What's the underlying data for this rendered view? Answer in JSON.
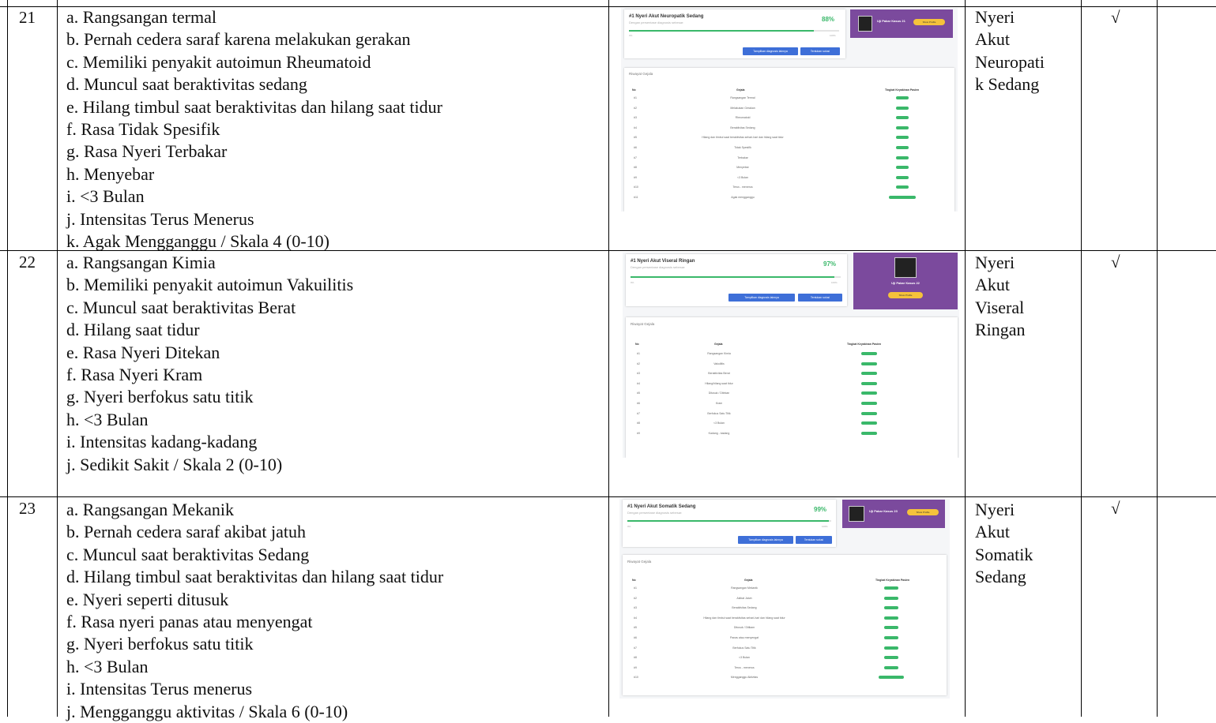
{
  "rows": [
    {
      "number": "21",
      "items": [
        "a. Rangsangan termal",
        "b. Pernah cedera saraf karena melakukan gerakan",
        "c. Memiliki penyakit autoimun Rheumatoid",
        "d. Muncul saat beraktivitas sedang",
        "e. Hilang timbul saat beraktivitas dan hilang saat tidur",
        "f. Rasa Tidak Spesifik",
        "g. Rasa Nyeri Terbakar",
        "h. Menyebar",
        "i. <3 Bulan",
        "j. Intensitas Terus Menerus",
        "k. Agak Mengganggu / Skala 4 (0-10)"
      ],
      "diagnosis": [
        "Nyeri",
        "Akut",
        "Neuropati",
        "k Sedang"
      ],
      "check": "√",
      "screenshot": {
        "title": "#1 Nyeri Akut Neuropatik Sedang",
        "subtitle": "Dengan persentase diagnosis sebesar:",
        "percent": "88%",
        "progress": 0.88,
        "tick_min": "0%",
        "tick_max": "100%",
        "button_primary": "Tampilkan diagnosis lainnya",
        "button_secondary": "Tentukan solusi",
        "profile_name": "Uji Pakar Kasus 21",
        "profile_button": "Show Profile",
        "history_title": "Riwayat Gejala",
        "col_no": "No",
        "col_gejala": "Gejala",
        "col_level": "Tingkat Keyakinan Pasien",
        "table": [
          {
            "no": "#1",
            "gejala": "Rangsangan Termal",
            "pill": "short"
          },
          {
            "no": "#2",
            "gejala": "Melakukan Gerakan",
            "pill": "short"
          },
          {
            "no": "#3",
            "gejala": "Rheumatoid",
            "pill": "short"
          },
          {
            "no": "#4",
            "gejala": "Beraktivitas Sedang",
            "pill": "short"
          },
          {
            "no": "#5",
            "gejala": "Hilang dan timbul saat beraktivitas sehari-hari dan hilang saat tidur",
            "pill": "short"
          },
          {
            "no": "#6",
            "gejala": "Tidak Spesifik",
            "pill": "short"
          },
          {
            "no": "#7",
            "gejala": "Terbakar",
            "pill": "short"
          },
          {
            "no": "#8",
            "gejala": "Menyebar",
            "pill": "short"
          },
          {
            "no": "#9",
            "gejala": "<3 Bulan",
            "pill": "short"
          },
          {
            "no": "#10",
            "gejala": "Terus - menerus",
            "pill": "short"
          },
          {
            "no": "#11",
            "gejala": "Agak mengganggu",
            "pill": "long"
          }
        ]
      }
    },
    {
      "number": "22",
      "items": [
        "a. Rangsangan Kimia",
        "b. Memiliki penyakit autoimun Vakuilitis",
        "c. Muncul saat beraktivitas Berat",
        "d. Hilang saat tidur",
        "e. Rasa Nyeri Ditekan",
        "f. Rasa Nyeri Kram",
        "g. Nyeri berfokus satu titik",
        "h. <3 Bulan",
        "i. Intensitas kadang-kadang",
        "j. Sedikit Sakit / Skala 2 (0-10)"
      ],
      "diagnosis": [
        "Nyeri",
        "Akut",
        "Viseral",
        "Ringan"
      ],
      "check": "√",
      "screenshot": {
        "title": "#1 Nyeri Akut Viseral Ringan",
        "subtitle": "Dengan persentase diagnosis sebesar:",
        "percent": "97%",
        "progress": 0.97,
        "tick_min": "0%",
        "tick_max": "100%",
        "button_primary": "Tampilkan diagnosis lainnya",
        "button_secondary": "Tentukan solusi",
        "profile_name": "Uji Pakar Kasus 22",
        "profile_button": "Show Profile",
        "history_title": "Riwayat Gejala",
        "col_no": "No",
        "col_gejala": "Gejala",
        "col_level": "Tingkat Keyakinan Pasien",
        "table": [
          {
            "no": "#1",
            "gejala": "Rangsangan Kimia",
            "pill": "short"
          },
          {
            "no": "#2",
            "gejala": "Vakuilitis",
            "pill": "short"
          },
          {
            "no": "#3",
            "gejala": "Beraktivitas Berat",
            "pill": "short"
          },
          {
            "no": "#4",
            "gejala": "Hilang/hilang saat tidur",
            "pill": "short"
          },
          {
            "no": "#5",
            "gejala": "Ditusuk / Ditekan",
            "pill": "short"
          },
          {
            "no": "#6",
            "gejala": "Kram",
            "pill": "short"
          },
          {
            "no": "#7",
            "gejala": "Berfokus Satu Titik",
            "pill": "short"
          },
          {
            "no": "#8",
            "gejala": "<3 Bulan",
            "pill": "short"
          },
          {
            "no": "#9",
            "gejala": "Kadang - kadang",
            "pill": "short"
          }
        ]
      }
    },
    {
      "number": "23",
      "items": [
        "a. Rangsangan Mekanik",
        "b. Pernah cedera saraf akibat jatuh",
        "c. Muncul saat beraktivitas Sedang",
        "d. Hilang timbul saat beraktivitas dan hilang saat tidur",
        "e. Nyeri seperti ditusuk",
        "f. Rasa nyeri panas atau menyengat",
        "g. Nyeri berfokus satu titik",
        "h. <3 Bulan",
        "i. Intensitas Terus menerus",
        "j. Mengganggu aktivitas / Skala 6 (0-10)"
      ],
      "diagnosis": [
        "Nyeri",
        "Akut",
        "Somatik",
        "Sedang"
      ],
      "check": "√",
      "screenshot": {
        "title": "#1 Nyeri Akut Somatik Sedang",
        "subtitle": "Dengan persentase diagnosis sebesar:",
        "percent": "99%",
        "progress": 0.99,
        "tick_min": "0%",
        "tick_max": "100%",
        "button_primary": "Tampilkan diagnosis lainnya",
        "button_secondary": "Tentukan solusi",
        "profile_name": "Uji Pakar Kasus 23",
        "profile_button": "Show Profile",
        "history_title": "Riwayat Gejala",
        "col_no": "No",
        "col_gejala": "Gejala",
        "col_level": "Tingkat Keyakinan Pasien",
        "table": [
          {
            "no": "#1",
            "gejala": "Rangsangan Mekanik",
            "pill": "short"
          },
          {
            "no": "#2",
            "gejala": "Akibat Jatuh",
            "pill": "short"
          },
          {
            "no": "#3",
            "gejala": "Beraktivitas Sedang",
            "pill": "short"
          },
          {
            "no": "#4",
            "gejala": "Hilang dan timbul saat beraktivitas sehari-hari dan hilang saat tidur",
            "pill": "short"
          },
          {
            "no": "#5",
            "gejala": "Ditusuk / Ditikam",
            "pill": "short"
          },
          {
            "no": "#6",
            "gejala": "Panas atau menyengat",
            "pill": "short"
          },
          {
            "no": "#7",
            "gejala": "Berfokus Satu Titik",
            "pill": "short"
          },
          {
            "no": "#8",
            "gejala": "<3 Bulan",
            "pill": "short"
          },
          {
            "no": "#9",
            "gejala": "Terus - menerus",
            "pill": "short"
          },
          {
            "no": "#10",
            "gejala": "Mengganggu Aktivitas",
            "pill": "long"
          }
        ]
      }
    }
  ],
  "colors": {
    "accent_green": "#3ab86a",
    "button_blue": "#3e6fd8",
    "profile_purple": "#7b4a9d",
    "profile_button_yellow": "#f5c23b"
  }
}
